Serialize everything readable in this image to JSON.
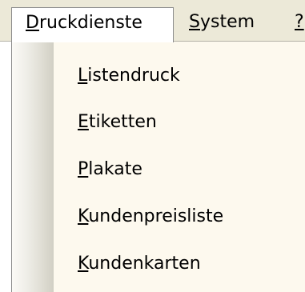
{
  "menubar": {
    "items": [
      {
        "mnemonic": "D",
        "rest": "ruckdienste"
      },
      {
        "mnemonic": "S",
        "rest": "ystem"
      },
      {
        "mnemonic": "?",
        "rest": ""
      }
    ]
  },
  "dropdown": {
    "items": [
      {
        "mnemonic": "L",
        "rest": "istendruck"
      },
      {
        "mnemonic": "E",
        "rest": "tiketten"
      },
      {
        "mnemonic": "P",
        "rest": "lakate"
      },
      {
        "mnemonic": "K",
        "rest": "undenpreisliste"
      },
      {
        "mnemonic": "K",
        "rest": "undenkarten"
      }
    ]
  }
}
